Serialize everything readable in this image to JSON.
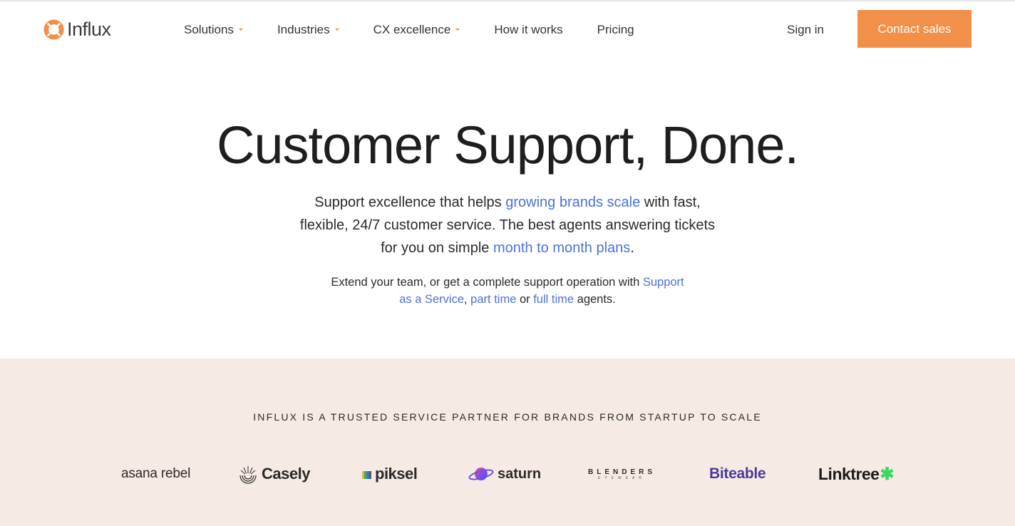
{
  "brand": {
    "name": "Influx",
    "accent": "#f28f49",
    "link_color": "#4a72d8"
  },
  "nav": {
    "items": [
      {
        "label": "Solutions",
        "has_dropdown": true
      },
      {
        "label": "Industries",
        "has_dropdown": true
      },
      {
        "label": "CX excellence",
        "has_dropdown": true
      },
      {
        "label": "How it works",
        "has_dropdown": false
      },
      {
        "label": "Pricing",
        "has_dropdown": false
      }
    ],
    "sign_in": "Sign in",
    "cta": "Contact sales"
  },
  "hero": {
    "title": "Customer Support, Done.",
    "sub": {
      "p1": "Support excellence that helps ",
      "link1": "growing brands scale",
      "p2": " with fast, flexible, 24/7 customer service. The best agents answering tickets for you on simple ",
      "link2": "month to month plans",
      "p3": "."
    },
    "sub2": {
      "p1": "Extend your team, or get a complete support operation with ",
      "link1": "Support as a Service",
      "p2": ", ",
      "link2": "part time",
      "p3": " or ",
      "link3": "full time",
      "p4": " agents."
    }
  },
  "partners": {
    "heading": "INFLUX IS A TRUSTED SERVICE PARTNER FOR BRANDS FROM STARTUP TO SCALE",
    "background": "#f6ebe4",
    "logos": {
      "asana_rebel": "asana rebel",
      "casely": "Casely",
      "piksel": "piksel",
      "saturn": "saturn",
      "blenders": "BLENDERS",
      "blenders_sub": "EYEWEAR",
      "biteable": "Biteable",
      "linktree": "Linktree"
    }
  }
}
